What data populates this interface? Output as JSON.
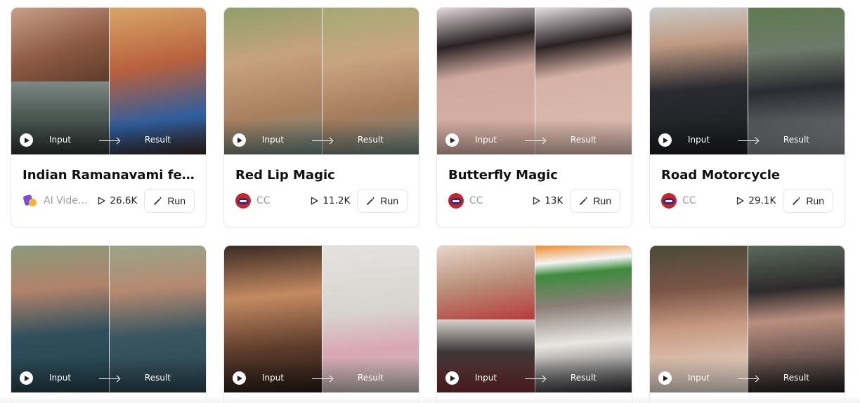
{
  "thumbnail_labels": {
    "input": "Input",
    "result": "Result"
  },
  "cards": [
    {
      "title": "Indian Ramanavami festi…",
      "author": "AI Video…",
      "author_avatar": "app-logo-icon",
      "plays": "26.6K",
      "run_label": "Run",
      "colors": [
        "#a9765a",
        "#4d5b55",
        "#b8613d"
      ]
    },
    {
      "title": "Red Lip Magic",
      "author": "CC",
      "author_avatar": "cc-avatar-icon",
      "plays": "11.2K",
      "run_label": "Run",
      "colors": [
        "#c7a27f",
        "#c9a481"
      ]
    },
    {
      "title": "Butterfly Magic",
      "author": "CC",
      "author_avatar": "cc-avatar-icon",
      "plays": "13K",
      "run_label": "Run",
      "colors": [
        "#cfa9a0",
        "#d6b2a6"
      ]
    },
    {
      "title": "Road Motorcycle",
      "author": "CC",
      "author_avatar": "cc-avatar-icon",
      "plays": "29.1K",
      "run_label": "Run",
      "colors": [
        "#2a2b30",
        "#6d7a6a"
      ]
    },
    {
      "title": "",
      "author": "",
      "plays": "",
      "run_label": "",
      "colors": [
        "#2f4f5c",
        "#3a5660"
      ]
    },
    {
      "title": "",
      "author": "",
      "plays": "",
      "run_label": "",
      "colors": [
        "#5a3a2a",
        "#d8d4d0"
      ]
    },
    {
      "title": "",
      "author": "",
      "plays": "",
      "run_label": "",
      "colors": [
        "#b98f7a",
        "#3a3537",
        "#8b7f78"
      ]
    },
    {
      "title": "",
      "author": "",
      "plays": "",
      "run_label": "",
      "colors": [
        "#7a5546",
        "#2d2a2c"
      ]
    }
  ]
}
